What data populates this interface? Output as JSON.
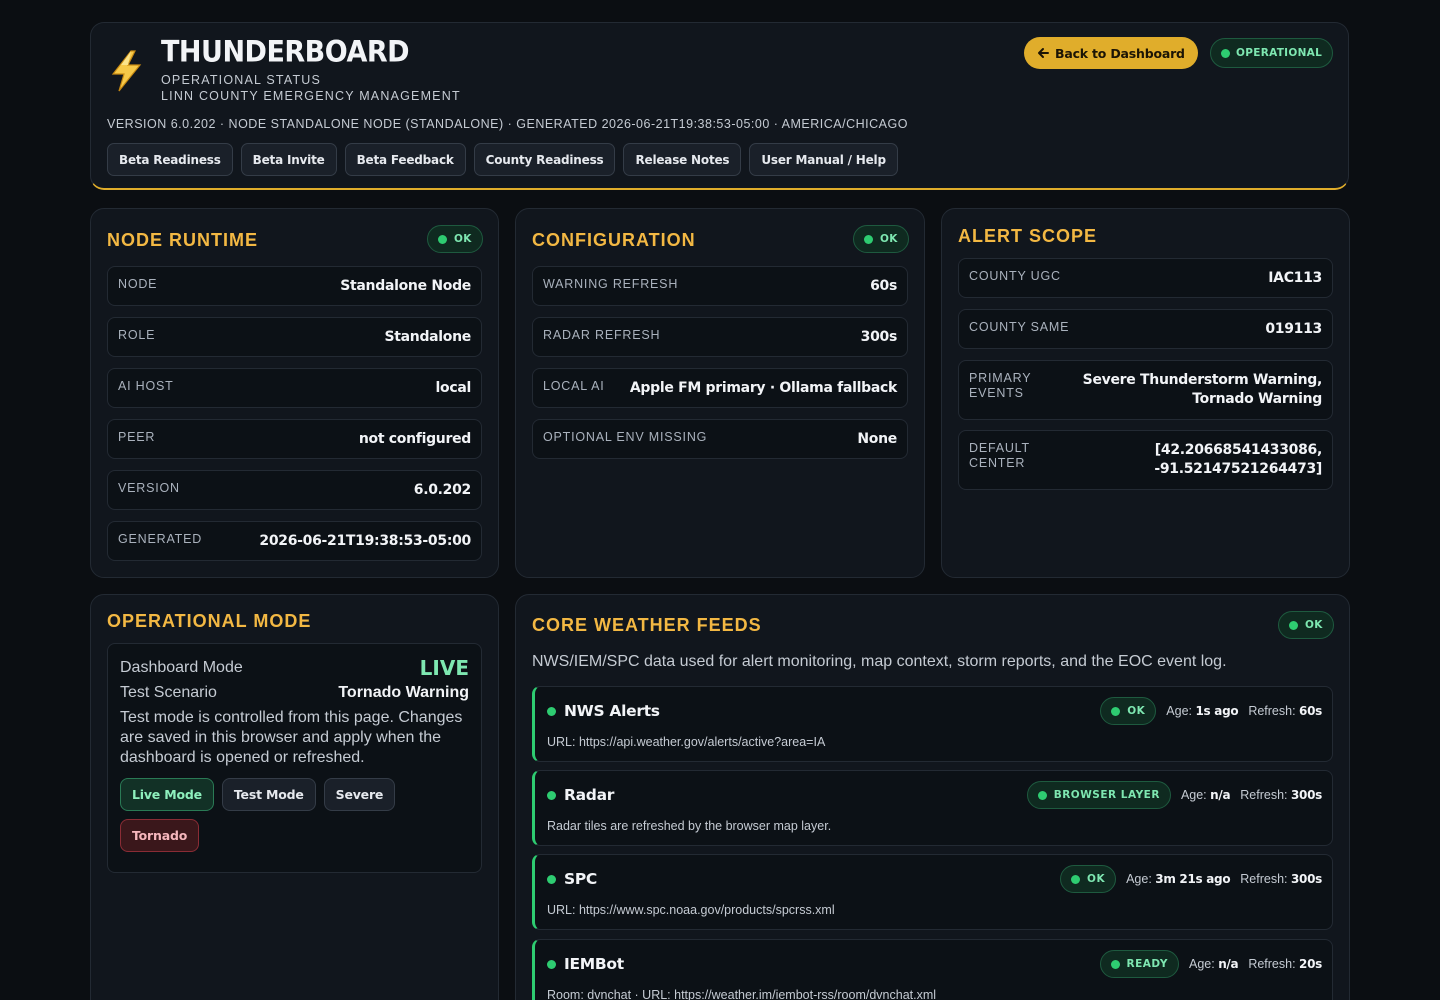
{
  "header": {
    "title": "THUNDERBOARD",
    "subtitle_1": "OPERATIONAL STATUS",
    "subtitle_2": "LINN COUNTY EMERGENCY MANAGEMENT",
    "meta": "VERSION 6.0.202 · NODE STANDALONE NODE (STANDALONE) · GENERATED 2026-06-21T19:38:53-05:00 · AMERICA/CHICAGO",
    "back_label": "Back to Dashboard",
    "status_label": "OPERATIONAL",
    "nav": [
      "Beta Readiness",
      "Beta Invite",
      "Beta Feedback",
      "County Readiness",
      "Release Notes",
      "User Manual / Help"
    ]
  },
  "node_runtime": {
    "title": "NODE RUNTIME",
    "status": "OK",
    "rows": [
      {
        "label": "NODE",
        "value": "Standalone Node"
      },
      {
        "label": "ROLE",
        "value": "Standalone"
      },
      {
        "label": "AI HOST",
        "value": "local"
      },
      {
        "label": "PEER",
        "value": "not configured"
      },
      {
        "label": "VERSION",
        "value": "6.0.202"
      },
      {
        "label": "GENERATED",
        "value": "2026-06-21T19:38:53-05:00"
      }
    ]
  },
  "configuration": {
    "title": "CONFIGURATION",
    "status": "OK",
    "rows": [
      {
        "label": "WARNING REFRESH",
        "value": "60s"
      },
      {
        "label": "RADAR REFRESH",
        "value": "300s"
      },
      {
        "label": "LOCAL AI",
        "value": "Apple FM primary · Ollama fallback"
      },
      {
        "label": "OPTIONAL ENV MISSING",
        "value": "None"
      }
    ]
  },
  "alert_scope": {
    "title": "ALERT SCOPE",
    "rows": [
      {
        "label": "COUNTY UGC",
        "value": "IAC113"
      },
      {
        "label": "COUNTY SAME",
        "value": "019113"
      },
      {
        "label_1": "PRIMARY",
        "label_2": "EVENTS",
        "value_1": "Severe Thunderstorm Warning,",
        "value_2": "Tornado Warning"
      },
      {
        "label_1": "DEFAULT",
        "label_2": "CENTER",
        "value_1": "[42.20668541433086,",
        "value_2": "-91.52147521264473]"
      }
    ]
  },
  "operational_mode": {
    "title": "OPERATIONAL MODE",
    "dashboard_mode_label": "Dashboard Mode",
    "dashboard_mode_value": "LIVE",
    "test_scenario_label": "Test Scenario",
    "test_scenario_value": "Tornado Warning",
    "note": "Test mode is controlled from this page. Changes are saved in this browser and apply when the dashboard is opened or refreshed.",
    "buttons": [
      "Live Mode",
      "Test Mode",
      "Severe",
      "Tornado"
    ]
  },
  "feeds": {
    "title": "CORE WEATHER FEEDS",
    "status": "OK",
    "description": "NWS/IEM/SPC data used for alert monitoring, map context, storm reports, and the EOC event log.",
    "age_label": "Age:",
    "refresh_label": "Refresh:",
    "items": [
      {
        "name": "NWS Alerts",
        "status": "OK",
        "age": "1s ago",
        "refresh": "60s",
        "detail": "URL: https://api.weather.gov/alerts/active?area=IA"
      },
      {
        "name": "Radar",
        "status": "BROWSER LAYER",
        "age": "n/a",
        "refresh": "300s",
        "detail": "Radar tiles are refreshed by the browser map layer."
      },
      {
        "name": "SPC",
        "status": "OK",
        "age": "3m 21s ago",
        "refresh": "300s",
        "detail": "URL: https://www.spc.noaa.gov/products/spcrss.xml"
      },
      {
        "name": "IEMBot",
        "status": "READY",
        "age": "n/a",
        "refresh": "20s",
        "detail": "Room: dvnchat · URL: https://weather.im/iembot-rss/room/dvnchat.xml"
      }
    ]
  },
  "colors": {
    "accent": "#f3b843",
    "ok_green": "#2ecc71",
    "back_button": "#e0ad2b",
    "tornado": "#8a2c35"
  }
}
